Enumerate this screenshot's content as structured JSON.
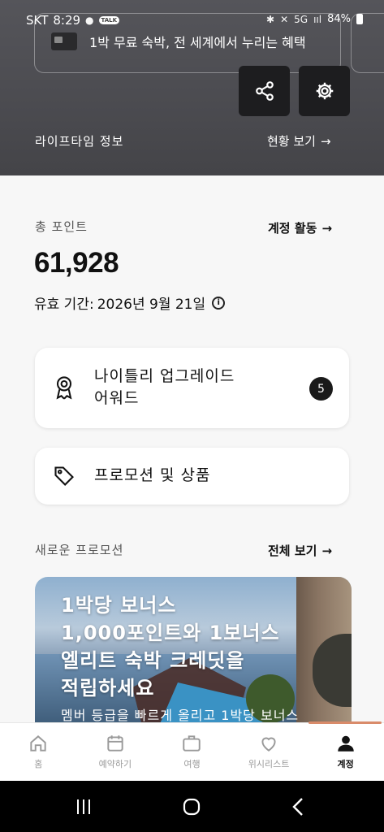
{
  "status_bar": {
    "carrier": "SKT",
    "time": "8:29",
    "talk_badge": "TALK",
    "network": "5G",
    "signal": "ııl",
    "battery": "84%"
  },
  "header": {
    "promo_banner_text": "1박 무료 숙박, 전 세계에서 누리는 혜택",
    "lifetime_label": "라이프타임 정보",
    "lifetime_link": "현황 보기",
    "arrow": "→"
  },
  "points": {
    "label": "총 포인트",
    "link": "계정 활동",
    "value": "61,928",
    "expiry_label": "유효 기간:",
    "expiry_date": "2026년 9월 21일"
  },
  "cards": {
    "upgrade_title_line1": "나이틀리 업그레이드",
    "upgrade_title_line2": "어워드",
    "upgrade_count": "5",
    "promotions_title": "프로모션 및 상품"
  },
  "new_promotions": {
    "label": "새로운 프로모션",
    "link": "전체 보기",
    "headline_line1": "1박당 보너스",
    "headline_line2": "1,000포인트와 1보너스",
    "headline_line3": "엘리트 숙박 크레딧을",
    "headline_line4": "적립하세요",
    "subtext": "멤버 등급을 빠르게 올리고 1박당 보너스"
  },
  "bottom_nav": {
    "items": [
      {
        "label": "홈",
        "icon": "home-icon"
      },
      {
        "label": "예약하기",
        "icon": "calendar-icon"
      },
      {
        "label": "여행",
        "icon": "suitcase-icon"
      },
      {
        "label": "위시리스트",
        "icon": "heart-icon"
      },
      {
        "label": "계정",
        "icon": "person-icon"
      }
    ],
    "active_index": 4
  },
  "colors": {
    "header_bg": "#4b4b50",
    "accent": "#d98b6a",
    "badge_bg": "#1a1a1a"
  }
}
